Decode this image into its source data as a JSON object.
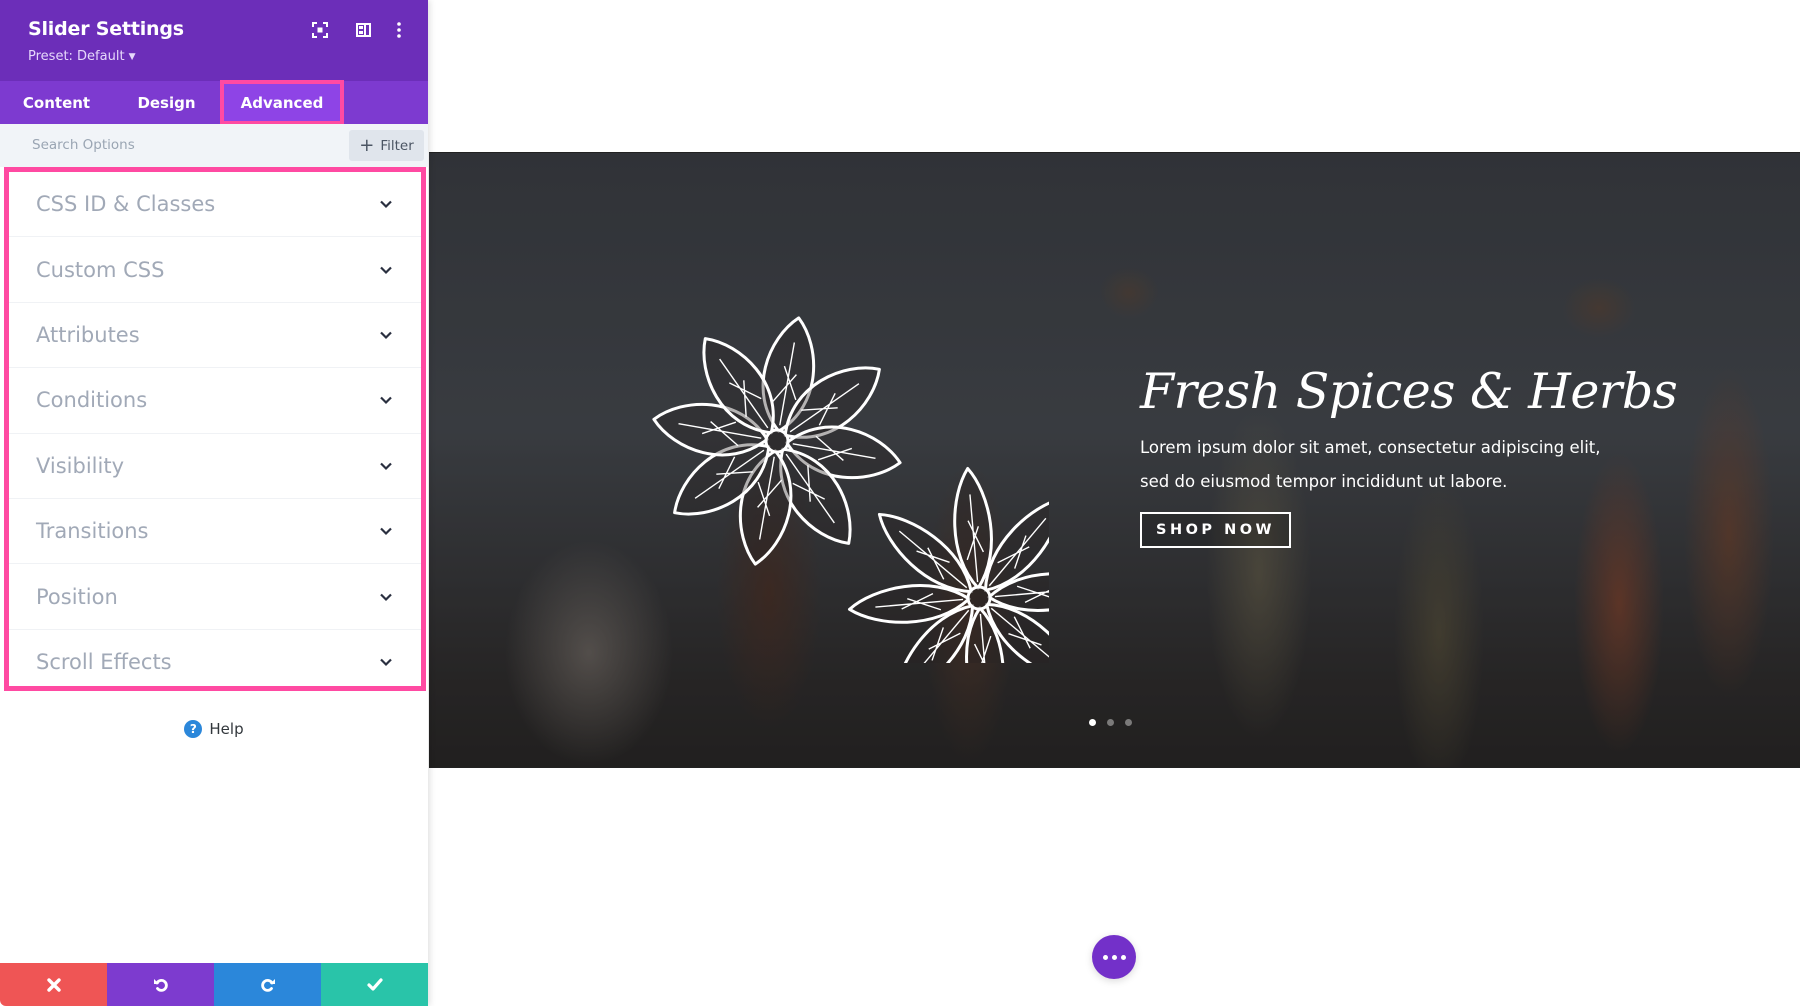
{
  "panel": {
    "title": "Slider Settings",
    "preset": "Preset: Default",
    "header_icons": [
      "focus-mode-icon",
      "split-view-icon",
      "more-vertical-icon"
    ],
    "tabs": [
      {
        "label": "Content",
        "active": false
      },
      {
        "label": "Design",
        "active": false
      },
      {
        "label": "Advanced",
        "active": true
      }
    ],
    "search": {
      "placeholder": "Search Options"
    },
    "filter_label": "Filter",
    "groups": [
      {
        "label": "CSS ID & Classes"
      },
      {
        "label": "Custom CSS"
      },
      {
        "label": "Attributes"
      },
      {
        "label": "Conditions"
      },
      {
        "label": "Visibility"
      },
      {
        "label": "Transitions"
      },
      {
        "label": "Position"
      },
      {
        "label": "Scroll Effects"
      }
    ],
    "help_label": "Help",
    "actions": [
      {
        "name": "discard",
        "icon": "close-icon",
        "color": "#ef5555"
      },
      {
        "name": "undo",
        "icon": "undo-icon",
        "color": "#7d3bcf"
      },
      {
        "name": "redo",
        "icon": "redo-icon",
        "color": "#2b87da"
      },
      {
        "name": "save",
        "icon": "check-icon",
        "color": "#29c4a9"
      }
    ]
  },
  "colors": {
    "header": "#6c2eb9",
    "tabs": "#7d3ad0",
    "active_tab": "#8e44e6",
    "highlight": "#ff4aa2"
  },
  "slide": {
    "heading": "Fresh Spices & Herbs",
    "body_line1": "Lorem ipsum dolor sit amet, consectetur adipiscing elit,",
    "body_line2": "sed do eiusmod tempor incididunt ut labore.",
    "button": "SHOP NOW",
    "slide_count": 3,
    "active_slide": 1
  }
}
